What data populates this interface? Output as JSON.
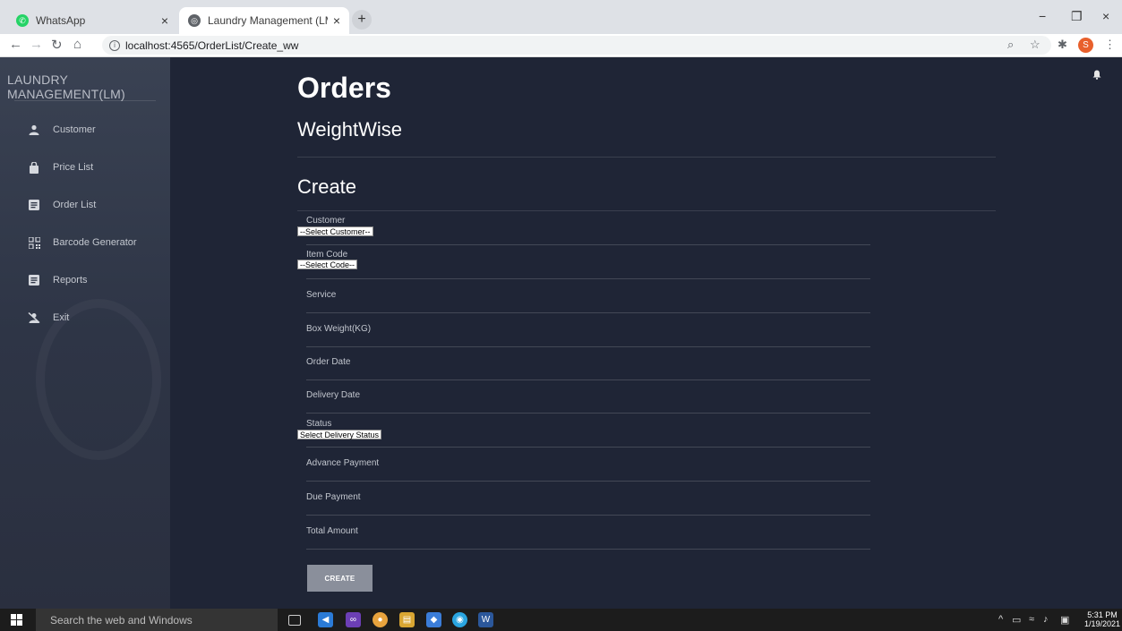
{
  "browser": {
    "tabs": [
      {
        "title": "WhatsApp",
        "close": "×"
      },
      {
        "title": "Laundry Management (LM)!",
        "close": "×"
      }
    ],
    "new_tab": "+",
    "url": "localhost:4565/OrderList/Create_ww",
    "profile_initial": "S",
    "window_controls": {
      "minimize": "−",
      "maximize": "❐",
      "close": "×"
    }
  },
  "sidebar": {
    "brand": "LAUNDRY MANAGEMENT(LM)",
    "items": [
      {
        "label": "Customer",
        "icon": "person-icon"
      },
      {
        "label": "Price List",
        "icon": "bag-icon"
      },
      {
        "label": "Order List",
        "icon": "list-icon"
      },
      {
        "label": "Barcode Generator",
        "icon": "qr-icon"
      },
      {
        "label": "Reports",
        "icon": "report-icon"
      },
      {
        "label": "Exit",
        "icon": "exit-icon"
      }
    ]
  },
  "main": {
    "title": "Orders",
    "subtitle": "WeightWise",
    "section": "Create",
    "fields": {
      "customer": {
        "label": "Customer",
        "value": "--Select Customer--"
      },
      "item_code": {
        "label": "Item Code",
        "value": "--Select Code--"
      },
      "service": {
        "label": "Service"
      },
      "box_weight": {
        "label": "Box Weight(KG)"
      },
      "order_date": {
        "label": "Order Date"
      },
      "delivery_date": {
        "label": "Delivery Date"
      },
      "status": {
        "label": "Status",
        "value": "Select Delivery Status"
      },
      "advance_payment": {
        "label": "Advance Payment"
      },
      "due_payment": {
        "label": "Due Payment"
      },
      "total_amount": {
        "label": "Total Amount"
      }
    },
    "create_button": "CREATE"
  },
  "taskbar": {
    "search_placeholder": "Search the web and Windows",
    "time": "5:31 PM",
    "date": "1/19/2021"
  }
}
